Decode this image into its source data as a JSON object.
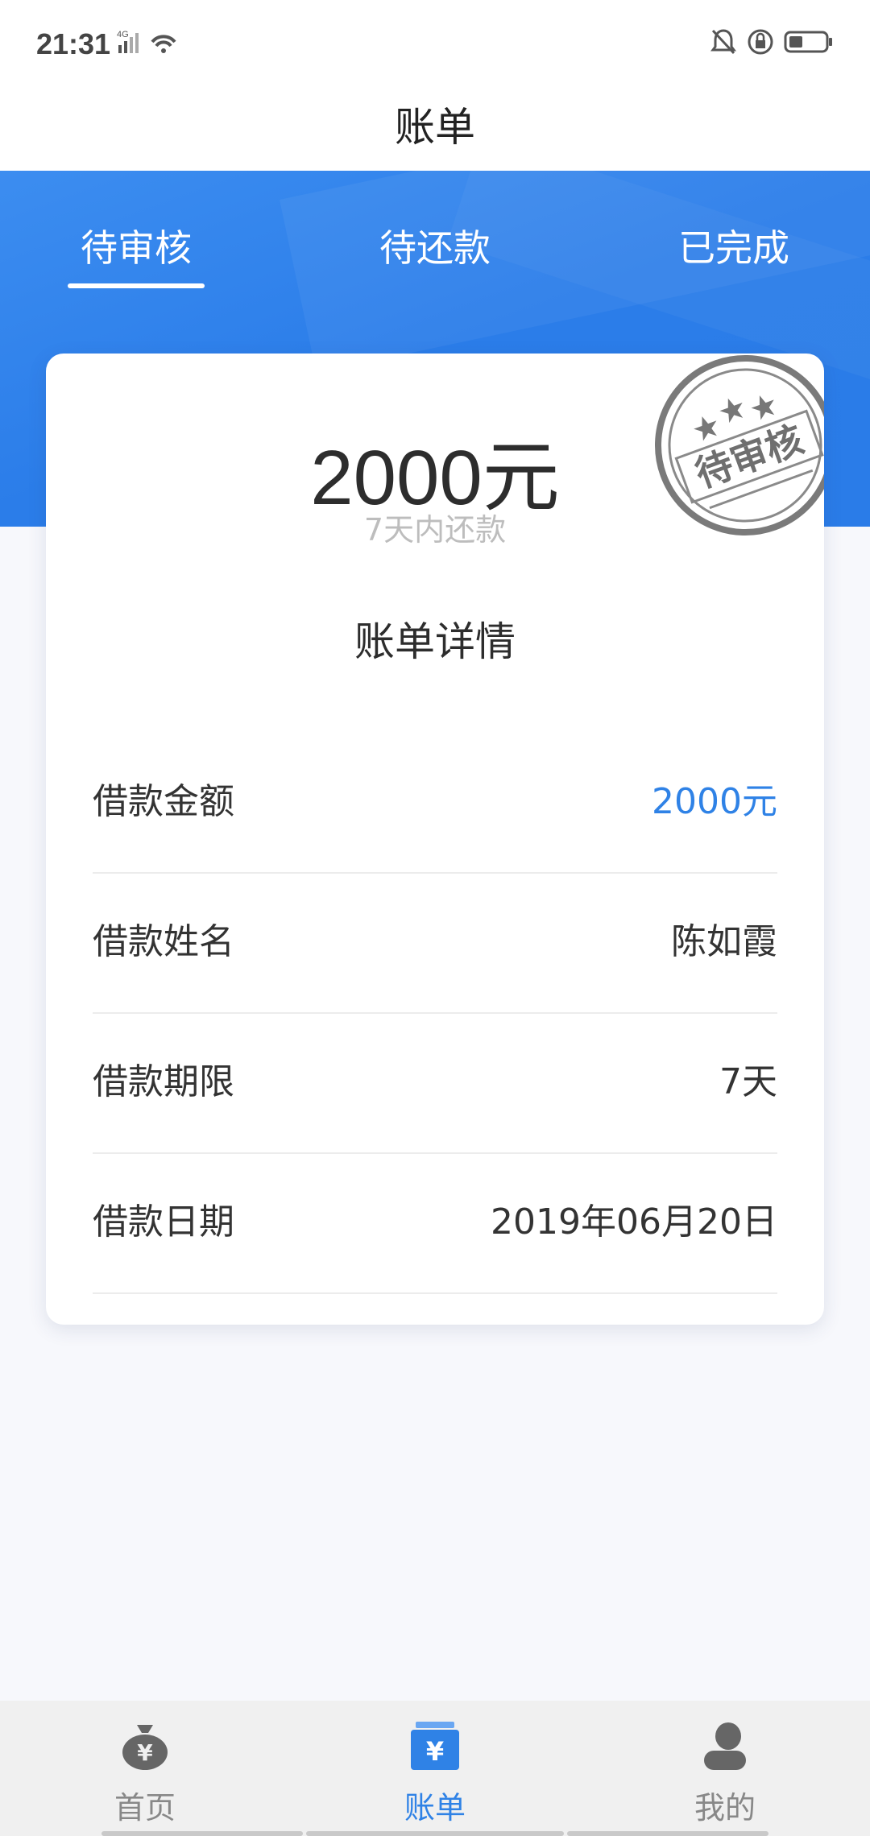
{
  "status_bar": {
    "time": "21:31",
    "network": "4G"
  },
  "header": {
    "title": "账单"
  },
  "tabs": [
    {
      "label": "待审核",
      "active": true
    },
    {
      "label": "待还款",
      "active": false
    },
    {
      "label": "已完成",
      "active": false
    }
  ],
  "card": {
    "amount": "2000元",
    "amount_sub": "7天内还款",
    "stamp_text": "待审核",
    "detail_title": "账单详情",
    "rows": [
      {
        "label": "借款金额",
        "value": "2000元"
      },
      {
        "label": "借款姓名",
        "value": "陈如霞"
      },
      {
        "label": "借款期限",
        "value": "7天"
      },
      {
        "label": "借款日期",
        "value": "2019年06月20日"
      }
    ]
  },
  "bottom_nav": [
    {
      "label": "首页",
      "icon": "money-bag-icon",
      "active": false
    },
    {
      "label": "账单",
      "icon": "bill-icon",
      "active": true
    },
    {
      "label": "我的",
      "icon": "user-icon",
      "active": false
    }
  ],
  "colors": {
    "primary": "#2f82e6",
    "banner": "#2b7de9",
    "background": "#f7f8fc"
  }
}
